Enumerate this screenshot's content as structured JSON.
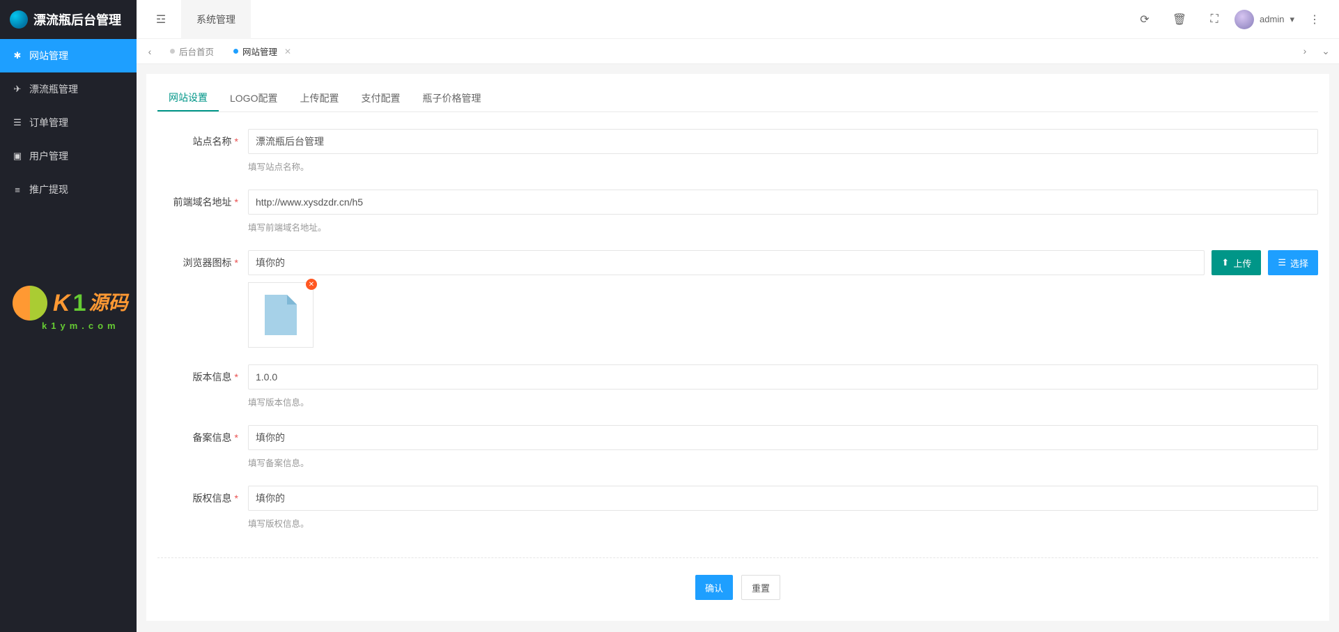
{
  "header": {
    "brand_title": "漂流瓶后台管理",
    "system_tab": "系统管理",
    "username": "admin"
  },
  "sidebar": {
    "items": [
      {
        "label": "网站管理"
      },
      {
        "label": "漂流瓶管理"
      },
      {
        "label": "订单管理"
      },
      {
        "label": "用户管理"
      },
      {
        "label": "推广提现"
      }
    ]
  },
  "tabstrip": {
    "tabs": [
      {
        "label": "后台首页"
      },
      {
        "label": "网站管理"
      }
    ]
  },
  "inner_tabs": {
    "items": [
      {
        "label": "网站设置"
      },
      {
        "label": "LOGO配置"
      },
      {
        "label": "上传配置"
      },
      {
        "label": "支付配置"
      },
      {
        "label": "瓶子价格管理"
      }
    ]
  },
  "form": {
    "site_name": {
      "label": "站点名称",
      "value": "漂流瓶后台管理",
      "help": "填写站点名称。"
    },
    "domain": {
      "label": "前端域名地址",
      "value": "http://www.xysdzdr.cn/h5",
      "help": "填写前端域名地址。"
    },
    "favicon": {
      "label": "浏览器图标",
      "value": "填你的",
      "upload": "上传",
      "select": "选择"
    },
    "version": {
      "label": "版本信息",
      "value": "1.0.0",
      "help": "填写版本信息。"
    },
    "beian": {
      "label": "备案信息",
      "value": "填你的",
      "help": "填写备案信息。"
    },
    "copyright": {
      "label": "版权信息",
      "value": "填你的",
      "help": "填写版权信息。"
    },
    "buttons": {
      "confirm": "确认",
      "reset": "重置"
    }
  },
  "watermark": {
    "text_k": "K",
    "text_1": "1",
    "text_cn": "源码",
    "sub": "k1ym.com"
  }
}
